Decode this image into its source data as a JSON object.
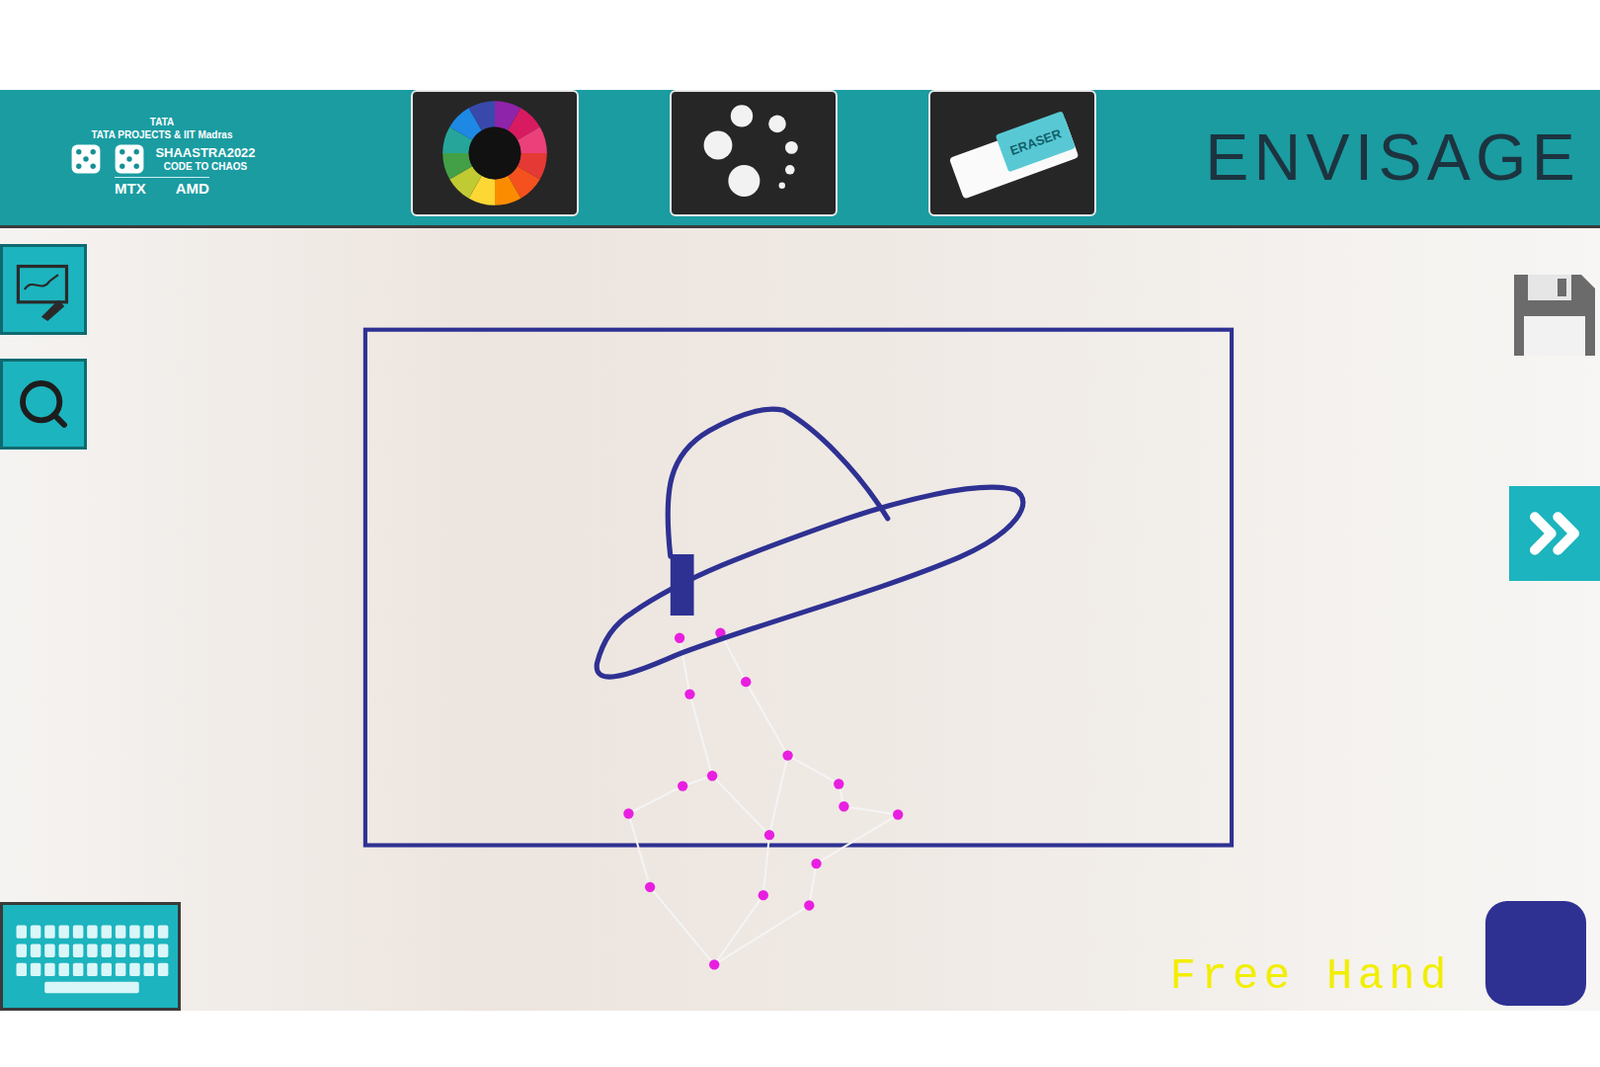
{
  "header": {
    "logo": {
      "brand": "TATA",
      "partners": "TATA PROJECTS & IIT Madras",
      "event": "SHAASTRA2022",
      "tagline": "CODE TO CHAOS",
      "sponsors": [
        "MTX",
        "AMD"
      ]
    },
    "eraser_label": "ERASER",
    "title": "ENVISAGE"
  },
  "status": {
    "mode": "Free Hand"
  },
  "brush": {
    "color": "#2e3192"
  }
}
